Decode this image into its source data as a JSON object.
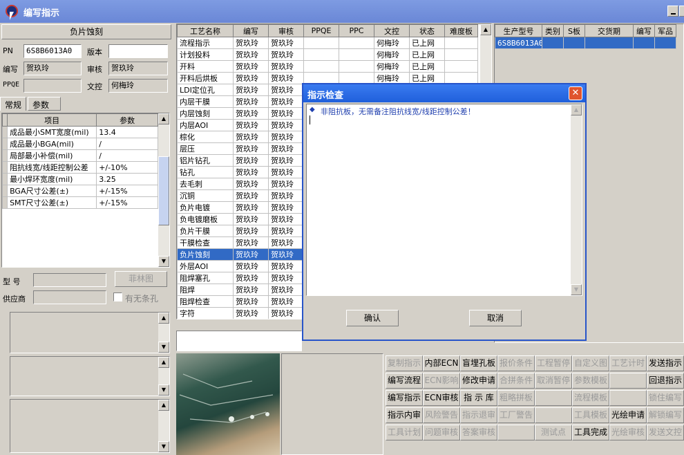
{
  "window": {
    "title": "编写指示"
  },
  "left": {
    "process_name": "负片蚀刻",
    "pn_label": "PN",
    "pn_value": "6S8B6013A0",
    "version_label": "版本",
    "version_value": "",
    "writer_label": "编写",
    "writer_value": "贺玖玲",
    "reviewer_label": "审核",
    "reviewer_value": "贺玖玲",
    "ppqe_label": "PPQE",
    "ppqe_value": "",
    "doc_control_label": "文控",
    "doc_control_value": "何梅玲",
    "tabs": [
      {
        "label": "常规"
      },
      {
        "label": "参数"
      }
    ],
    "param_headers": {
      "item": "项目",
      "param": "参数"
    },
    "params": [
      {
        "item": "成品最小SMT宽度(mil)",
        "value": "13.4"
      },
      {
        "item": "成品最小BGA(mil)",
        "value": "/"
      },
      {
        "item": "局部最小补偿(mil)",
        "value": "/"
      },
      {
        "item": "阻抗线宽/线距控制公差",
        "value": "+/-10%"
      },
      {
        "item": "最小焊环宽度(mil)",
        "value": "3.25"
      },
      {
        "item": "BGA尺寸公差(±)",
        "value": "+/-15%"
      },
      {
        "item": "SMT尺寸公差(±)",
        "value": "+/-15%"
      }
    ],
    "model_label": "型 号",
    "model_value": "",
    "film_button": "菲林图",
    "supplier_label": "供应商",
    "supplier_value": "",
    "no_strip_hole_label": "有无条孔"
  },
  "process_table": {
    "headers": [
      "工艺名称",
      "编写",
      "审核",
      "PPQE",
      "PPC",
      "文控",
      "状态",
      "难度板"
    ],
    "rows": [
      [
        "流程指示",
        "贺玖玲",
        "贺玖玲",
        "",
        "",
        "何梅玲",
        "已上网",
        ""
      ],
      [
        "计划投料",
        "贺玖玲",
        "贺玖玲",
        "",
        "",
        "何梅玲",
        "已上网",
        ""
      ],
      [
        "开料",
        "贺玖玲",
        "贺玖玲",
        "",
        "",
        "何梅玲",
        "已上网",
        ""
      ],
      [
        "开料后烘板",
        "贺玖玲",
        "贺玖玲",
        "",
        "",
        "何梅玲",
        "已上网",
        ""
      ],
      [
        "LDI定位孔",
        "贺玖玲",
        "贺玖玲",
        "",
        "",
        "",
        "",
        ""
      ],
      [
        "内层干膜",
        "贺玖玲",
        "贺玖玲",
        "",
        "",
        "",
        "",
        ""
      ],
      [
        "内层蚀刻",
        "贺玖玲",
        "贺玖玲",
        "",
        "",
        "",
        "",
        ""
      ],
      [
        "内层AOI",
        "贺玖玲",
        "贺玖玲",
        "",
        "",
        "",
        "",
        ""
      ],
      [
        "棕化",
        "贺玖玲",
        "贺玖玲",
        "",
        "",
        "",
        "",
        ""
      ],
      [
        "层压",
        "贺玖玲",
        "贺玖玲",
        "",
        "",
        "",
        "",
        ""
      ],
      [
        "铝片钻孔",
        "贺玖玲",
        "贺玖玲",
        "",
        "",
        "",
        "",
        ""
      ],
      [
        "钻孔",
        "贺玖玲",
        "贺玖玲",
        "",
        "",
        "",
        "",
        ""
      ],
      [
        "去毛刺",
        "贺玖玲",
        "贺玖玲",
        "",
        "",
        "",
        "",
        ""
      ],
      [
        "沉铜",
        "贺玖玲",
        "贺玖玲",
        "",
        "",
        "",
        "",
        ""
      ],
      [
        "负片电镀",
        "贺玖玲",
        "贺玖玲",
        "",
        "",
        "",
        "",
        ""
      ],
      [
        "负电镀磨板",
        "贺玖玲",
        "贺玖玲",
        "",
        "",
        "",
        "",
        ""
      ],
      [
        "负片干膜",
        "贺玖玲",
        "贺玖玲",
        "",
        "",
        "",
        "",
        ""
      ],
      [
        "干膜检查",
        "贺玖玲",
        "贺玖玲",
        "",
        "",
        "",
        "",
        ""
      ],
      [
        "负片蚀刻",
        "贺玖玲",
        "贺玖玲",
        "",
        "",
        "",
        "",
        ""
      ],
      [
        "外层AOI",
        "贺玖玲",
        "贺玖玲",
        "",
        "",
        "",
        "",
        ""
      ],
      [
        "阻焊塞孔",
        "贺玖玲",
        "贺玖玲",
        "",
        "",
        "",
        "",
        ""
      ],
      [
        "阻焊",
        "贺玖玲",
        "贺玖玲",
        "",
        "",
        "",
        "",
        ""
      ],
      [
        "阻焊检查",
        "贺玖玲",
        "贺玖玲",
        "",
        "",
        "",
        "",
        ""
      ],
      [
        "字符",
        "贺玖玲",
        "贺玖玲",
        "",
        "",
        "",
        "",
        ""
      ]
    ],
    "selected_row": 18
  },
  "production_table": {
    "headers": [
      "生产型号",
      "类别",
      "S板",
      "交货期",
      "编写",
      "军品"
    ],
    "rows": [
      [
        "6S8B6013A0",
        "",
        "",
        "",
        "",
        ""
      ]
    ]
  },
  "buttons": [
    [
      {
        "label": "复制指示",
        "enabled": false
      },
      {
        "label": "内部ECN",
        "enabled": true
      },
      {
        "label": "盲埋孔板",
        "enabled": true
      },
      {
        "label": "报价条件",
        "enabled": false
      },
      {
        "label": "工程暂停",
        "enabled": false
      },
      {
        "label": "自定义图",
        "enabled": false
      },
      {
        "label": "工艺计时",
        "enabled": false
      },
      {
        "label": "发送指示",
        "enabled": true
      }
    ],
    [
      {
        "label": "编写流程",
        "enabled": true
      },
      {
        "label": "ECN影响",
        "enabled": false
      },
      {
        "label": "修改申请",
        "enabled": true
      },
      {
        "label": "合拼条件",
        "enabled": false
      },
      {
        "label": "取消暂停",
        "enabled": false
      },
      {
        "label": "参数模板",
        "enabled": false
      },
      {
        "label": "",
        "enabled": false
      },
      {
        "label": "回退指示",
        "enabled": true
      }
    ],
    [
      {
        "label": "编写指示",
        "enabled": true
      },
      {
        "label": "ECN审核",
        "enabled": true
      },
      {
        "label": "指 示 库",
        "enabled": true
      },
      {
        "label": "粗略拼板",
        "enabled": false
      },
      {
        "label": "",
        "enabled": false
      },
      {
        "label": "流程模板",
        "enabled": false
      },
      {
        "label": "",
        "enabled": false
      },
      {
        "label": "锁住编写",
        "enabled": false
      }
    ],
    [
      {
        "label": "指示内审",
        "enabled": true
      },
      {
        "label": "风险警告",
        "enabled": false
      },
      {
        "label": "指示退审",
        "enabled": false
      },
      {
        "label": "工厂警告",
        "enabled": false
      },
      {
        "label": "",
        "enabled": false
      },
      {
        "label": "工具模板",
        "enabled": false
      },
      {
        "label": "光绘申请",
        "enabled": true
      },
      {
        "label": "解锁编写",
        "enabled": false
      }
    ],
    [
      {
        "label": "工具计划",
        "enabled": false
      },
      {
        "label": "问题审核",
        "enabled": false
      },
      {
        "label": "答案审核",
        "enabled": false
      },
      {
        "label": "",
        "enabled": false
      },
      {
        "label": "测试点",
        "enabled": false
      },
      {
        "label": "工具完成",
        "enabled": true
      },
      {
        "label": "光绘审核",
        "enabled": false
      },
      {
        "label": "发送文控",
        "enabled": false
      }
    ]
  ],
  "dialog": {
    "title": "指示检查",
    "message": "非阻抗板，无需备注阻抗线宽/线距控制公差！",
    "confirm": "确认",
    "cancel": "取消"
  }
}
